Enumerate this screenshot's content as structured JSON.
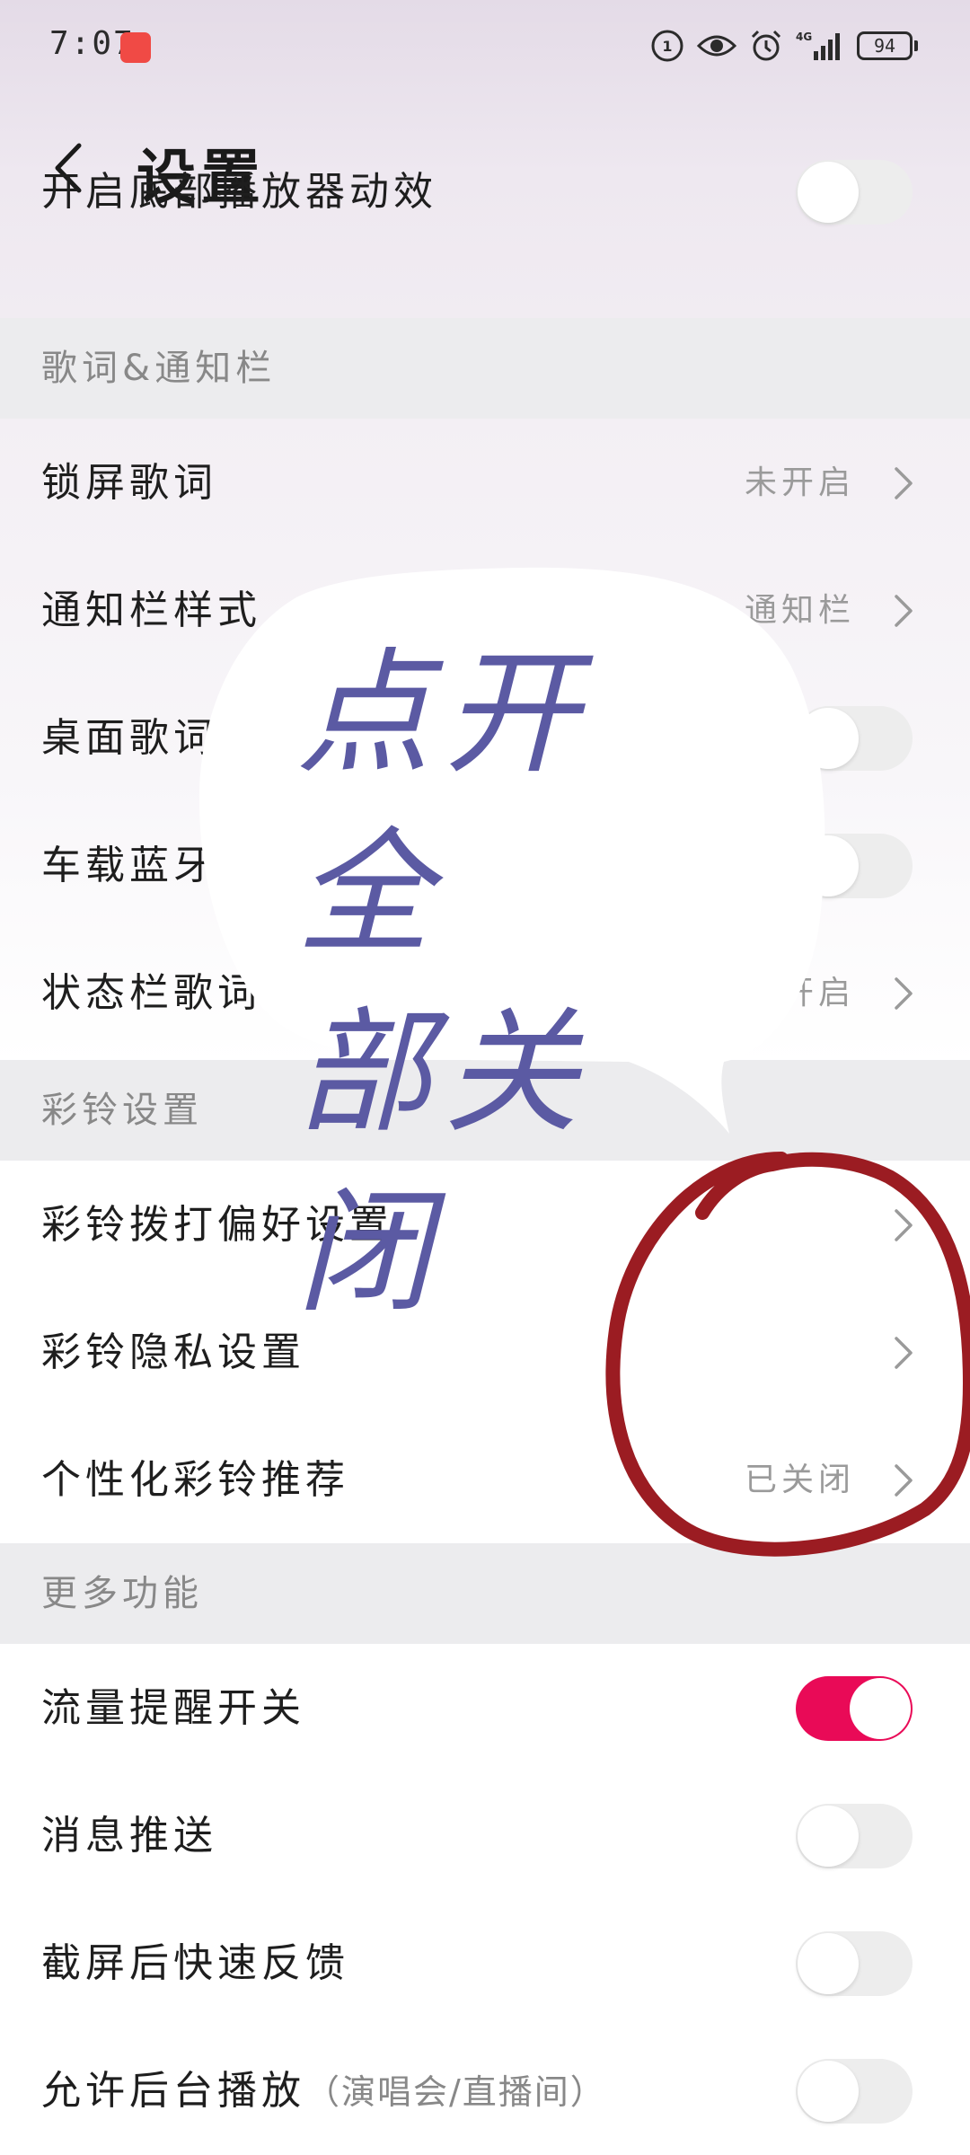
{
  "status_bar": {
    "time": "7:07",
    "network": "4G",
    "battery": "94"
  },
  "header": {
    "title": "设置"
  },
  "rows": {
    "bottom_player_anim": {
      "label": "开启底部播放器动效",
      "toggle": "off"
    },
    "lockscreen_lyrics": {
      "label": "锁屏歌词",
      "value": "未开启"
    },
    "notification_style": {
      "label": "通知栏样式",
      "value": "通知栏"
    },
    "desktop_lyrics": {
      "label": "桌面歌词",
      "toggle": "off"
    },
    "car_bluetooth": {
      "label": "车载蓝牙歌词",
      "toggle": "off"
    },
    "statusbar_lyrics": {
      "label": "状态栏歌词",
      "value": "开启"
    },
    "ringtone_dial_pref": {
      "label": "彩铃拨打偏好设置"
    },
    "ringtone_privacy": {
      "label": "彩铃隐私设置"
    },
    "personalized_ringtone": {
      "label": "个性化彩铃推荐",
      "value": "已关闭"
    },
    "data_reminder": {
      "label": "流量提醒开关",
      "toggle": "on"
    },
    "push_messages": {
      "label": "消息推送",
      "toggle": "off"
    },
    "screenshot_feedback": {
      "label": "截屏后快速反馈",
      "toggle": "off"
    },
    "background_play": {
      "label": "允许后台播放",
      "sub": "（演唱会/直播间）",
      "toggle": "off"
    }
  },
  "sections": {
    "lyrics_notification": "歌词&通知栏",
    "ringtone": "彩铃设置",
    "more": "更多功能"
  },
  "annotation": {
    "line1": "点开全",
    "line2": "部关闭"
  },
  "colors": {
    "accent": "#e90a57",
    "annotation_ink": "#5b5aa3",
    "annotation_circle": "#9b1c22"
  }
}
